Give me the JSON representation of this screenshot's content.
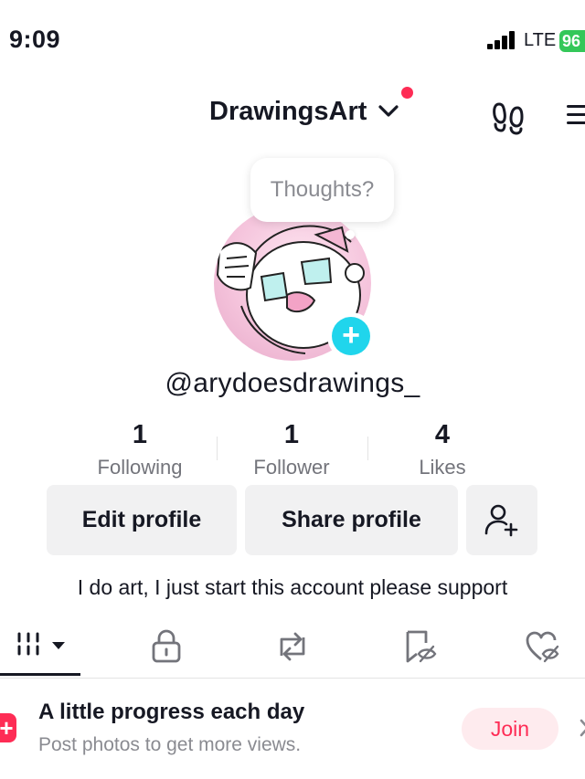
{
  "status_bar": {
    "time": "9:09",
    "network": "LTE",
    "battery": "96"
  },
  "header": {
    "title": "DrawingsArt"
  },
  "avatar": {
    "thought_prompt": "Thoughts?"
  },
  "profile": {
    "username": "@arydoesdrawings_",
    "stats": [
      {
        "value": "1",
        "label": "Following"
      },
      {
        "value": "1",
        "label": "Follower"
      },
      {
        "value": "4",
        "label": "Likes"
      }
    ],
    "edit_label": "Edit profile",
    "share_label": "Share profile",
    "bio": "I do art, I just start this account please support"
  },
  "tabs": [
    {
      "icon": "grid-videos-icon"
    },
    {
      "icon": "lock-icon"
    },
    {
      "icon": "repost-icon"
    },
    {
      "icon": "saved-eye-slash-icon"
    },
    {
      "icon": "liked-heart-eye-slash-icon"
    }
  ],
  "promo": {
    "title": "A little progress each day",
    "subtitle": "Post photos to get more views.",
    "join_label": "Join"
  },
  "colors": {
    "brand_red": "#fe2c55",
    "accent_cyan": "#20d5ec",
    "battery_green": "#34c759",
    "button_gray": "#f1f1f2",
    "text_primary": "#161823",
    "text_secondary": "#73747b"
  }
}
